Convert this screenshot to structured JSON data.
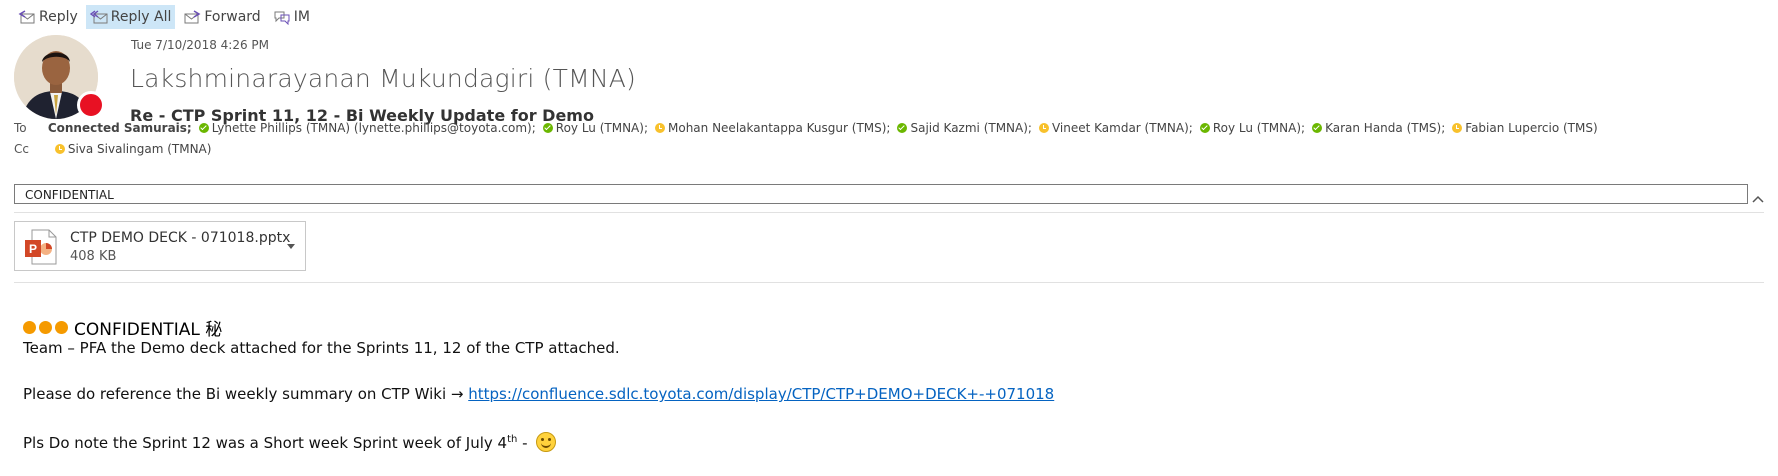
{
  "toolbar": {
    "reply_label": "Reply",
    "reply_all_label": "Reply All",
    "forward_label": "Forward",
    "im_label": "IM"
  },
  "message": {
    "date": "Tue 7/10/2018 4:26 PM",
    "sender": "Lakshminarayanan Mukundagiri (TMNA)",
    "subject": "Re - CTP Sprint 11, 12 - Bi Weekly Update for Demo",
    "presence_color": "#e81123"
  },
  "recipients": {
    "to_label": "To",
    "to": [
      {
        "name": "Connected Samurais;",
        "status": "none",
        "bold": true
      },
      {
        "name": "Lynette Phillips (TMNA) (lynette.phillips@toyota.com);",
        "status": "green"
      },
      {
        "name": "Roy Lu (TMNA);",
        "status": "green"
      },
      {
        "name": "Mohan Neelakantappa Kusgur (TMS);",
        "status": "yellow"
      },
      {
        "name": "Sajid Kazmi (TMNA);",
        "status": "green"
      },
      {
        "name": "Vineet Kamdar (TMNA);",
        "status": "yellow"
      },
      {
        "name": "Roy Lu (TMNA);",
        "status": "green"
      },
      {
        "name": "Karan Handa (TMS);",
        "status": "green"
      },
      {
        "name": "Fabian Lupercio (TMS)",
        "status": "yellow"
      }
    ],
    "cc_label": "Cc",
    "cc": [
      {
        "name": "Siva Sivalingam (TMNA)",
        "status": "yellow"
      }
    ]
  },
  "classification": "CONFIDENTIAL",
  "attachment": {
    "name": "CTP DEMO DECK - 071018.pptx",
    "size": "408 KB"
  },
  "body": {
    "confidential_label": "CONFIDENTIAL 秘",
    "line1": "Team – PFA the Demo deck attached for the Sprints 11, 12 of the CTP attached.",
    "line2_prefix": "Please do reference the Bi weekly summary on CTP Wiki →",
    "link": "https://confluence.sdlc.toyota.com/display/CTP/CTP+DEMO+DECK+-+071018",
    "line3_prefix": "Pls Do note the Sprint 12 was a Short week Sprint week of July 4",
    "line3_sup": "th",
    "line3_suffix": " -"
  },
  "colors": {
    "status_available": "#6bb700",
    "status_away": "#f8c12c",
    "confidential_dots": "#f59a00",
    "link": "#0563c1"
  }
}
